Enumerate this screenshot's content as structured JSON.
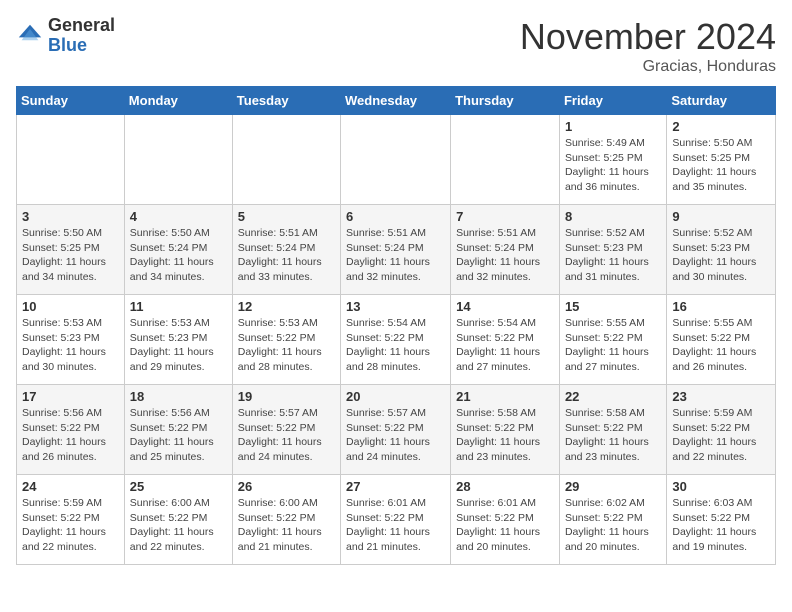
{
  "header": {
    "logo_general": "General",
    "logo_blue": "Blue",
    "month_title": "November 2024",
    "subtitle": "Gracias, Honduras"
  },
  "weekdays": [
    "Sunday",
    "Monday",
    "Tuesday",
    "Wednesday",
    "Thursday",
    "Friday",
    "Saturday"
  ],
  "weeks": [
    [
      {
        "day": "",
        "info": ""
      },
      {
        "day": "",
        "info": ""
      },
      {
        "day": "",
        "info": ""
      },
      {
        "day": "",
        "info": ""
      },
      {
        "day": "",
        "info": ""
      },
      {
        "day": "1",
        "info": "Sunrise: 5:49 AM\nSunset: 5:25 PM\nDaylight: 11 hours\nand 36 minutes."
      },
      {
        "day": "2",
        "info": "Sunrise: 5:50 AM\nSunset: 5:25 PM\nDaylight: 11 hours\nand 35 minutes."
      }
    ],
    [
      {
        "day": "3",
        "info": "Sunrise: 5:50 AM\nSunset: 5:25 PM\nDaylight: 11 hours\nand 34 minutes."
      },
      {
        "day": "4",
        "info": "Sunrise: 5:50 AM\nSunset: 5:24 PM\nDaylight: 11 hours\nand 34 minutes."
      },
      {
        "day": "5",
        "info": "Sunrise: 5:51 AM\nSunset: 5:24 PM\nDaylight: 11 hours\nand 33 minutes."
      },
      {
        "day": "6",
        "info": "Sunrise: 5:51 AM\nSunset: 5:24 PM\nDaylight: 11 hours\nand 32 minutes."
      },
      {
        "day": "7",
        "info": "Sunrise: 5:51 AM\nSunset: 5:24 PM\nDaylight: 11 hours\nand 32 minutes."
      },
      {
        "day": "8",
        "info": "Sunrise: 5:52 AM\nSunset: 5:23 PM\nDaylight: 11 hours\nand 31 minutes."
      },
      {
        "day": "9",
        "info": "Sunrise: 5:52 AM\nSunset: 5:23 PM\nDaylight: 11 hours\nand 30 minutes."
      }
    ],
    [
      {
        "day": "10",
        "info": "Sunrise: 5:53 AM\nSunset: 5:23 PM\nDaylight: 11 hours\nand 30 minutes."
      },
      {
        "day": "11",
        "info": "Sunrise: 5:53 AM\nSunset: 5:23 PM\nDaylight: 11 hours\nand 29 minutes."
      },
      {
        "day": "12",
        "info": "Sunrise: 5:53 AM\nSunset: 5:22 PM\nDaylight: 11 hours\nand 28 minutes."
      },
      {
        "day": "13",
        "info": "Sunrise: 5:54 AM\nSunset: 5:22 PM\nDaylight: 11 hours\nand 28 minutes."
      },
      {
        "day": "14",
        "info": "Sunrise: 5:54 AM\nSunset: 5:22 PM\nDaylight: 11 hours\nand 27 minutes."
      },
      {
        "day": "15",
        "info": "Sunrise: 5:55 AM\nSunset: 5:22 PM\nDaylight: 11 hours\nand 27 minutes."
      },
      {
        "day": "16",
        "info": "Sunrise: 5:55 AM\nSunset: 5:22 PM\nDaylight: 11 hours\nand 26 minutes."
      }
    ],
    [
      {
        "day": "17",
        "info": "Sunrise: 5:56 AM\nSunset: 5:22 PM\nDaylight: 11 hours\nand 26 minutes."
      },
      {
        "day": "18",
        "info": "Sunrise: 5:56 AM\nSunset: 5:22 PM\nDaylight: 11 hours\nand 25 minutes."
      },
      {
        "day": "19",
        "info": "Sunrise: 5:57 AM\nSunset: 5:22 PM\nDaylight: 11 hours\nand 24 minutes."
      },
      {
        "day": "20",
        "info": "Sunrise: 5:57 AM\nSunset: 5:22 PM\nDaylight: 11 hours\nand 24 minutes."
      },
      {
        "day": "21",
        "info": "Sunrise: 5:58 AM\nSunset: 5:22 PM\nDaylight: 11 hours\nand 23 minutes."
      },
      {
        "day": "22",
        "info": "Sunrise: 5:58 AM\nSunset: 5:22 PM\nDaylight: 11 hours\nand 23 minutes."
      },
      {
        "day": "23",
        "info": "Sunrise: 5:59 AM\nSunset: 5:22 PM\nDaylight: 11 hours\nand 22 minutes."
      }
    ],
    [
      {
        "day": "24",
        "info": "Sunrise: 5:59 AM\nSunset: 5:22 PM\nDaylight: 11 hours\nand 22 minutes."
      },
      {
        "day": "25",
        "info": "Sunrise: 6:00 AM\nSunset: 5:22 PM\nDaylight: 11 hours\nand 22 minutes."
      },
      {
        "day": "26",
        "info": "Sunrise: 6:00 AM\nSunset: 5:22 PM\nDaylight: 11 hours\nand 21 minutes."
      },
      {
        "day": "27",
        "info": "Sunrise: 6:01 AM\nSunset: 5:22 PM\nDaylight: 11 hours\nand 21 minutes."
      },
      {
        "day": "28",
        "info": "Sunrise: 6:01 AM\nSunset: 5:22 PM\nDaylight: 11 hours\nand 20 minutes."
      },
      {
        "day": "29",
        "info": "Sunrise: 6:02 AM\nSunset: 5:22 PM\nDaylight: 11 hours\nand 20 minutes."
      },
      {
        "day": "30",
        "info": "Sunrise: 6:03 AM\nSunset: 5:22 PM\nDaylight: 11 hours\nand 19 minutes."
      }
    ]
  ]
}
